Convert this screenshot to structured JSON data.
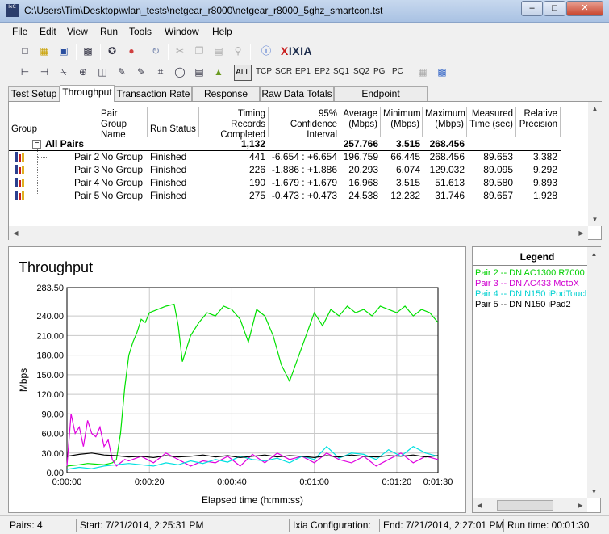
{
  "window": {
    "title": "C:\\Users\\Tim\\Desktop\\wlan_tests\\netgear_r8000\\netgear_r8000_5ghz_smartcon.tst",
    "app_icon_text": "IxC",
    "min_glyph": "–",
    "max_glyph": "□",
    "close_glyph": "✕"
  },
  "menu": [
    "File",
    "Edit",
    "View",
    "Run",
    "Tools",
    "Window",
    "Help"
  ],
  "toolbar2": {
    "all_label": "ALL",
    "protocol_filters": [
      "TCP",
      "SCR",
      "EP1",
      "EP2",
      "SQ1",
      "SQ2",
      "PG",
      "PC"
    ]
  },
  "logo": {
    "prefix": "",
    "x": "X",
    "rest": "IXIA"
  },
  "tabs": [
    "Test Setup",
    "Throughput",
    "Transaction Rate",
    "Response Time",
    "Raw Data Totals",
    "Endpoint Configuration"
  ],
  "active_tab": 1,
  "table": {
    "headers": {
      "group": "Group",
      "pair_group_name": [
        "Pair Group",
        "Name"
      ],
      "run_status": "Run Status",
      "timing_records": [
        "Timing Records",
        "Completed"
      ],
      "confidence": [
        "95% Confidence",
        "Interval"
      ],
      "average": [
        "Average",
        "(Mbps)"
      ],
      "minimum": [
        "Minimum",
        "(Mbps)"
      ],
      "maximum": [
        "Maximum",
        "(Mbps)"
      ],
      "measured_time": [
        "Measured",
        "Time (sec)"
      ],
      "relative_precision": [
        "Relative",
        "Precision"
      ]
    },
    "all_pairs": {
      "label": "All Pairs",
      "expander": "−",
      "records": "1,132",
      "average": "257.766",
      "minimum": "3.515",
      "maximum": "268.456"
    },
    "rows": [
      {
        "pair": "Pair 2",
        "group": "No Group",
        "status": "Finished",
        "records": "441",
        "ci": "-6.654 : +6.654",
        "average": "196.759",
        "minimum": "66.445",
        "maximum": "268.456",
        "time": "89.653",
        "precision": "3.382"
      },
      {
        "pair": "Pair 3",
        "group": "No Group",
        "status": "Finished",
        "records": "226",
        "ci": "-1.886 : +1.886",
        "average": "20.293",
        "minimum": "6.074",
        "maximum": "129.032",
        "time": "89.095",
        "precision": "9.292"
      },
      {
        "pair": "Pair 4",
        "group": "No Group",
        "status": "Finished",
        "records": "190",
        "ci": "-1.679 : +1.679",
        "average": "16.968",
        "minimum": "3.515",
        "maximum": "51.613",
        "time": "89.580",
        "precision": "9.893"
      },
      {
        "pair": "Pair 5",
        "group": "No Group",
        "status": "Finished",
        "records": "275",
        "ci": "-0.473 : +0.473",
        "average": "24.538",
        "minimum": "12.232",
        "maximum": "31.746",
        "time": "89.657",
        "precision": "1.928"
      }
    ]
  },
  "chart_data": {
    "type": "line",
    "title": "Throughput",
    "xlabel": "Elapsed time (h:mm:ss)",
    "ylabel": "Mbps",
    "x_ticks": [
      "0:00:00",
      "0:00:20",
      "0:00:40",
      "0:01:00",
      "0:01:20",
      "0:01:30"
    ],
    "x_tick_seconds": [
      0,
      20,
      40,
      60,
      80,
      90
    ],
    "xlim": [
      0,
      90
    ],
    "y_ticks": [
      "0.00",
      "30.00",
      "60.00",
      "90.00",
      "120.00",
      "150.00",
      "180.00",
      "210.00",
      "240.00",
      "283.50"
    ],
    "y_tick_values": [
      0,
      30,
      60,
      90,
      120,
      150,
      180,
      210,
      240,
      283.5
    ],
    "ylim": [
      0,
      283.5
    ],
    "grid": true,
    "series": [
      {
        "name": "Pair 2 -- DN AC1300 R7000",
        "color": "#00e000",
        "x": [
          0,
          3,
          5,
          7,
          9,
          11,
          12,
          13,
          14,
          15,
          16,
          17,
          18,
          19,
          20,
          22,
          24,
          26,
          27,
          28,
          30,
          32,
          34,
          36,
          38,
          40,
          42,
          44,
          46,
          48,
          50,
          52,
          54,
          56,
          58,
          60,
          62,
          64,
          66,
          68,
          70,
          72,
          74,
          76,
          78,
          80,
          82,
          84,
          86,
          88,
          90
        ],
        "y": [
          10,
          12,
          14,
          13,
          12,
          15,
          20,
          60,
          130,
          180,
          200,
          215,
          235,
          230,
          245,
          250,
          255,
          258,
          225,
          170,
          210,
          230,
          245,
          240,
          255,
          250,
          235,
          200,
          250,
          240,
          210,
          165,
          140,
          175,
          210,
          245,
          225,
          250,
          240,
          255,
          245,
          250,
          240,
          255,
          250,
          245,
          255,
          240,
          250,
          245,
          230
        ]
      },
      {
        "name": "Pair 3 -- DN AC433 MotoX",
        "color": "#e000e0",
        "x": [
          0,
          1,
          2,
          3,
          4,
          5,
          6,
          7,
          8,
          9,
          10,
          11,
          12,
          13,
          14,
          15,
          18,
          21,
          24,
          27,
          30,
          33,
          36,
          39,
          42,
          45,
          48,
          51,
          54,
          57,
          60,
          63,
          66,
          69,
          72,
          75,
          78,
          81,
          84,
          87,
          90
        ],
        "y": [
          10,
          90,
          60,
          70,
          40,
          80,
          60,
          55,
          70,
          40,
          50,
          20,
          10,
          15,
          20,
          18,
          25,
          15,
          30,
          20,
          10,
          18,
          15,
          25,
          10,
          28,
          15,
          30,
          20,
          25,
          15,
          30,
          20,
          15,
          25,
          10,
          20,
          30,
          15,
          25,
          20
        ]
      },
      {
        "name": "Pair 4 -- DN N150 iPodTouch",
        "color": "#00e0e0",
        "x": [
          0,
          3,
          6,
          9,
          12,
          15,
          18,
          21,
          24,
          27,
          30,
          33,
          36,
          39,
          42,
          45,
          48,
          51,
          54,
          57,
          60,
          63,
          66,
          69,
          72,
          75,
          78,
          81,
          84,
          87,
          90
        ],
        "y": [
          5,
          8,
          6,
          10,
          12,
          14,
          12,
          10,
          15,
          12,
          18,
          14,
          20,
          16,
          25,
          20,
          18,
          22,
          15,
          25,
          20,
          40,
          22,
          30,
          28,
          20,
          35,
          25,
          40,
          30,
          25
        ]
      },
      {
        "name": "Pair 5 -- DN N150 iPad2",
        "color": "#000000",
        "x": [
          0,
          3,
          6,
          9,
          12,
          15,
          18,
          21,
          24,
          27,
          30,
          33,
          36,
          39,
          42,
          45,
          48,
          51,
          54,
          57,
          60,
          63,
          66,
          69,
          72,
          75,
          78,
          81,
          84,
          87,
          90
        ],
        "y": [
          25,
          28,
          30,
          27,
          26,
          24,
          25,
          23,
          26,
          24,
          25,
          27,
          24,
          26,
          23,
          25,
          27,
          24,
          26,
          25,
          23,
          26,
          24,
          27,
          25,
          24,
          26,
          25,
          27,
          24,
          26
        ]
      }
    ]
  },
  "legend": {
    "title": "Legend",
    "items": [
      {
        "label": "Pair 2 -- DN AC1300 R7000",
        "color": "#00d000"
      },
      {
        "label": "Pair 3 -- DN AC433 MotoX",
        "color": "#d000d0"
      },
      {
        "label": "Pair 4 -- DN N150 iPodTouch",
        "color": "#00d0d0"
      },
      {
        "label": "Pair 5 -- DN N150 iPad2",
        "color": "#000000"
      }
    ]
  },
  "status": {
    "pairs": "Pairs: 4",
    "start": "Start: 7/21/2014, 2:25:31 PM",
    "ixia_config": "Ixia Configuration:",
    "end": "End: 7/21/2014, 2:27:01 PM",
    "runtime": "Run time: 00:01:30"
  }
}
